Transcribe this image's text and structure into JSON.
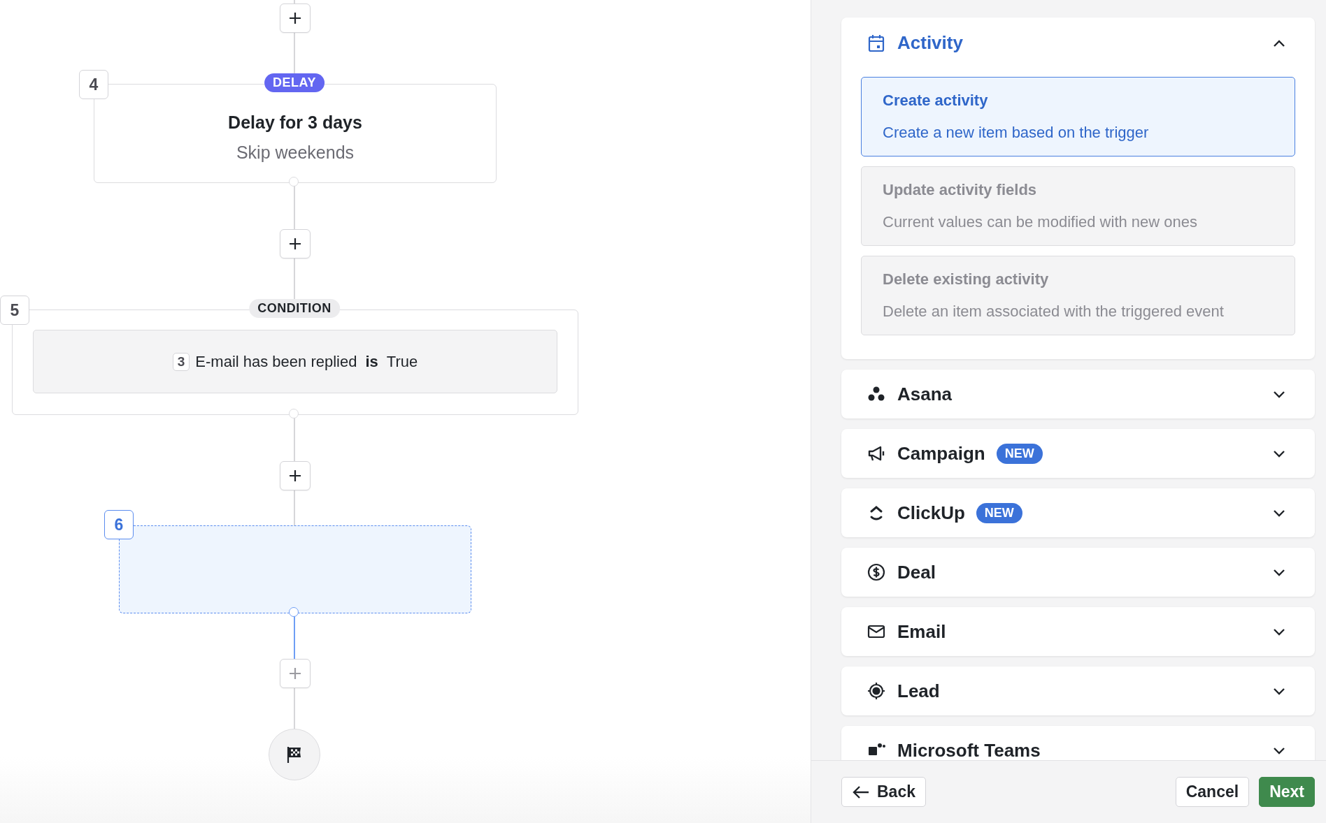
{
  "canvas": {
    "add_buttons": [
      {
        "disabled": false
      },
      {
        "disabled": false
      },
      {
        "disabled": false
      },
      {
        "disabled": true
      }
    ],
    "delay_step": {
      "number": "4",
      "badge": "DELAY",
      "title": "Delay for 3 days",
      "subtitle": "Skip weekends"
    },
    "condition_step": {
      "number": "5",
      "badge": "CONDITION",
      "rule": {
        "ref": "3",
        "field": "E-mail has been replied",
        "operator": "is",
        "value": "True"
      }
    },
    "new_step": {
      "number": "6",
      "selected": true
    }
  },
  "actions_panel": {
    "groups": [
      {
        "title": "Activity",
        "expanded": true,
        "options": [
          {
            "title": "Create activity",
            "description": "Create a new item based on the trigger",
            "selected": true
          },
          {
            "title": "Update activity fields",
            "description": "Current values can be modified with new ones",
            "selected": false
          },
          {
            "title": "Delete existing activity",
            "description": "Delete an item associated with the triggered event",
            "selected": false
          }
        ]
      },
      {
        "title": "Asana",
        "expanded": false
      },
      {
        "title": "Campaign",
        "expanded": false,
        "badge": "NEW"
      },
      {
        "title": "ClickUp",
        "expanded": false,
        "badge": "NEW"
      },
      {
        "title": "Deal",
        "expanded": false
      },
      {
        "title": "Email",
        "expanded": false
      },
      {
        "title": "Lead",
        "expanded": false
      },
      {
        "title": "Microsoft Teams",
        "expanded": false
      }
    ]
  },
  "footer": {
    "back": "Back",
    "cancel": "Cancel",
    "next": "Next"
  }
}
